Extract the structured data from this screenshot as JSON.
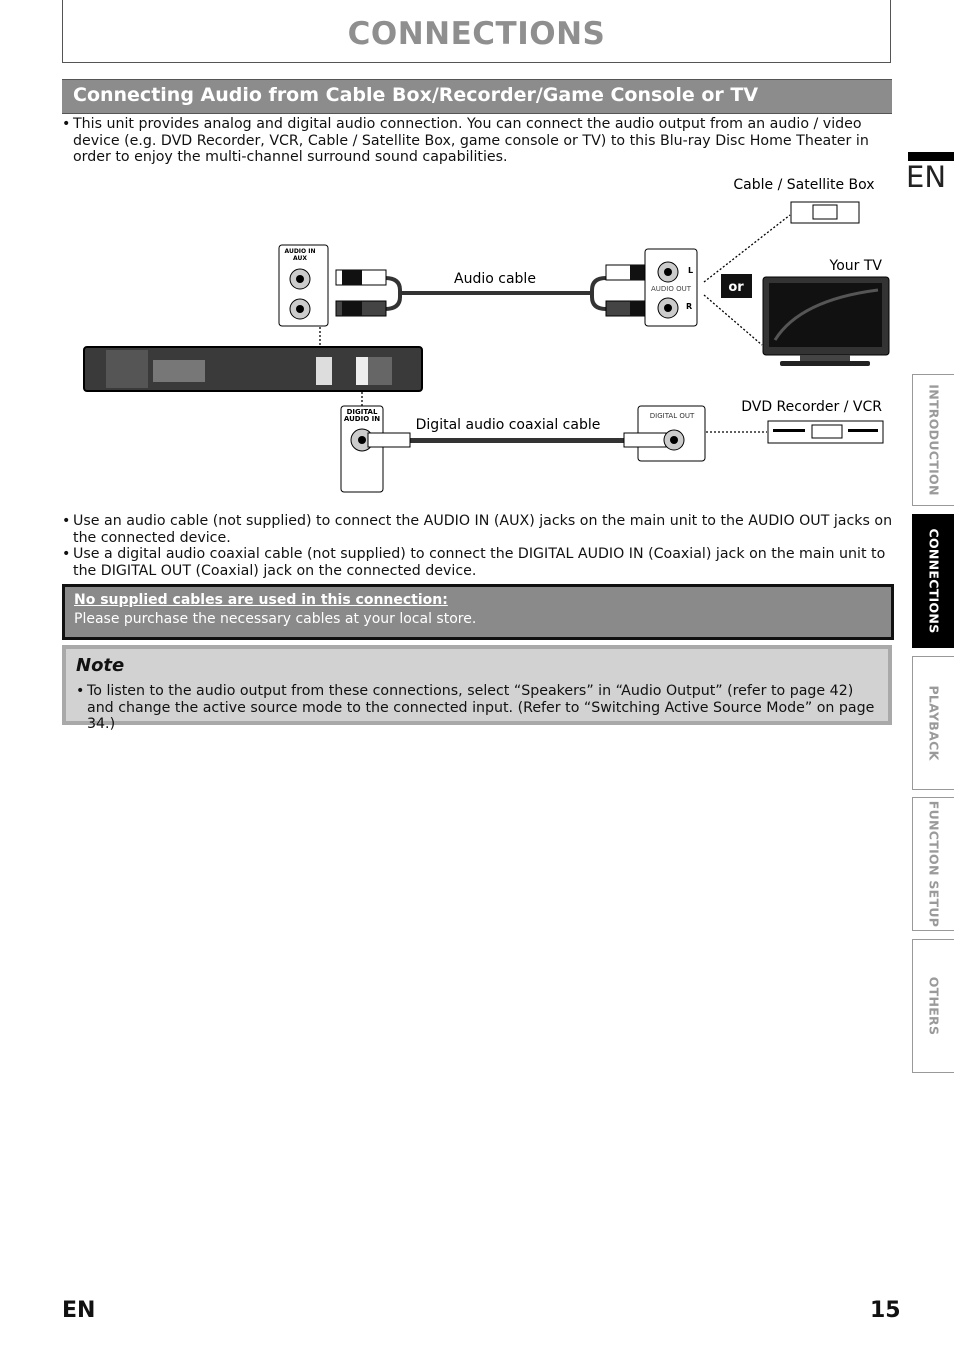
{
  "header": {
    "title": "CONNECTIONS"
  },
  "section": {
    "title": "Connecting Audio from Cable Box/Recorder/Game Console or TV"
  },
  "intro": "This unit provides analog and digital audio connection. You can connect the audio output from an audio / video device (e.g. DVD Recorder, VCR, Cable / Satellite Box, game console or TV) to this Blu-ray Disc Home Theater in order to enjoy the multi-channel surround sound capabilities.",
  "diagram": {
    "cable_box": "Cable / Satellite Box",
    "your_tv": "Your TV",
    "dvd_vcr": "DVD Recorder / VCR",
    "or": "or",
    "audio_cable": "Audio cable",
    "digital_cable": "Digital audio coaxial cable",
    "audio_in_aux_1": "AUDIO IN",
    "audio_in_aux_2": "AUX",
    "audio_out": "AUDIO OUT",
    "l": "L",
    "r": "R",
    "digital_audio_in_1": "DIGITAL",
    "digital_audio_in_2": "AUDIO IN",
    "digital_out": "DIGITAL OUT"
  },
  "bullets": [
    "Use an audio cable (not supplied) to connect the AUDIO IN (AUX) jacks on the main unit to the AUDIO OUT jacks on the connected device.",
    "Use a digital audio coaxial cable (not supplied) to connect the DIGITAL AUDIO IN (Coaxial) jack on the main unit to the DIGITAL OUT (Coaxial) jack on the connected device."
  ],
  "warning": {
    "heading": "No supplied cables are used in this connection:",
    "body": "Please purchase the necessary cables at your local store."
  },
  "note": {
    "heading": "Note",
    "text": "To listen to the audio output from these connections, select “Speakers” in “Audio Output” (refer to page 42) and change the active source mode to the connected input. (Refer to “Switching Active Source Mode” on page 34.)"
  },
  "side": {
    "lang": "EN",
    "tabs": [
      {
        "label": "INTRODUCTION",
        "active": false
      },
      {
        "label": "CONNECTIONS",
        "active": true
      },
      {
        "label": "PLAYBACK",
        "active": false
      },
      {
        "label": "FUNCTION SETUP",
        "active": false
      },
      {
        "label": "OTHERS",
        "active": false
      }
    ]
  },
  "footer": {
    "lang": "EN",
    "page": "15"
  }
}
